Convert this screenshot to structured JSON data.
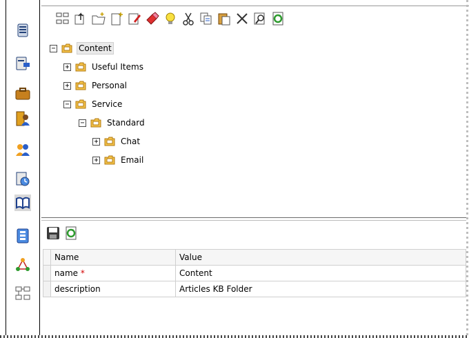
{
  "nav": {
    "items": [
      {
        "name": "nav-documents-icon"
      },
      {
        "name": "nav-reports-icon"
      },
      {
        "name": "nav-briefcase-icon"
      },
      {
        "name": "nav-contacts-icon"
      },
      {
        "name": "nav-users-icon"
      },
      {
        "name": "nav-schedule-icon"
      },
      {
        "name": "nav-knowledge-base-icon"
      },
      {
        "name": "nav-forms-icon"
      },
      {
        "name": "nav-workflow-icon"
      },
      {
        "name": "nav-hierarchy-icon"
      }
    ]
  },
  "toolbar": {
    "buttons": [
      "tree-view-icon",
      "move-up-icon",
      "new-folder-icon",
      "new-item-icon",
      "edit-icon",
      "paint-icon",
      "idea-icon",
      "cut-icon",
      "copy-icon",
      "paste-icon",
      "delete-icon",
      "search-icon",
      "refresh-icon"
    ]
  },
  "tree": {
    "root": "Content",
    "useful_items": "Useful Items",
    "personal": "Personal",
    "service": "Service",
    "standard": "Standard",
    "chat": "Chat",
    "email": "Email",
    "expand": "+",
    "collapse": "−"
  },
  "properties": {
    "header_name": "Name",
    "header_value": "Value",
    "rows": [
      {
        "name": "name",
        "required": "*",
        "value": "Content"
      },
      {
        "name": "description",
        "value": "Articles KB Folder"
      }
    ]
  },
  "colors": {
    "folder_fill": "#f5c34a",
    "folder_stroke": "#b07a10",
    "accent_blue": "#2a5fc9",
    "refresh_green": "#2e9b2e"
  }
}
